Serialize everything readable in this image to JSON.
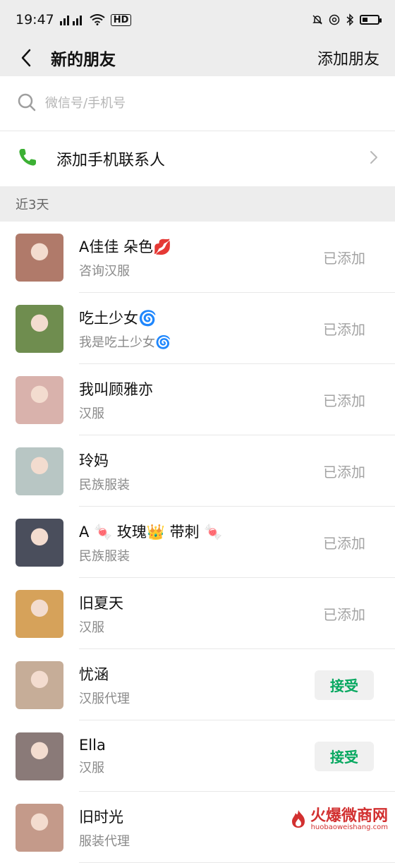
{
  "status_bar": {
    "time": "19:47",
    "signal1_label": "3G",
    "signal2_label": "4G",
    "hd_label": "HD"
  },
  "nav": {
    "title": "新的朋友",
    "action": "添加朋友"
  },
  "search": {
    "placeholder": "微信号/手机号"
  },
  "add_contacts": {
    "label": "添加手机联系人"
  },
  "section": {
    "title": "近3天"
  },
  "friends": [
    {
      "name": "A佳佳  朵色💋",
      "message": "咨询汉服",
      "status": "已添加",
      "avatar_color": "#b07a6a"
    },
    {
      "name": "吃土少女🌀",
      "message": "我是吃土少女🌀",
      "status": "已添加",
      "avatar_color": "#6f8d4f"
    },
    {
      "name": "我叫顾雅亦",
      "message": "汉服",
      "status": "已添加",
      "avatar_color": "#d9b2ac"
    },
    {
      "name": "玲妈",
      "message": "民族服装",
      "status": "已添加",
      "avatar_color": "#b8c6c4"
    },
    {
      "name": "A 🍬 玫瑰👑 带刺 🍬",
      "message": "民族服装",
      "status": "已添加",
      "avatar_color": "#4a4e5c"
    },
    {
      "name": "旧夏天",
      "message": "汉服",
      "status": "已添加",
      "avatar_color": "#d6a25a"
    },
    {
      "name": "忧涵",
      "message": "汉服代理",
      "accept_label": "接受",
      "avatar_color": "#c6ad98"
    },
    {
      "name": "Ella",
      "message": "汉服",
      "accept_label": "接受",
      "avatar_color": "#8a7a78"
    },
    {
      "name": "旧时光",
      "message": "服装代理",
      "avatar_color": "#c49a8a"
    }
  ],
  "watermark": {
    "text": "火爆微商网",
    "sub": "huobaoweishang.com"
  },
  "colors": {
    "header_bg": "#ededed",
    "accent_green": "#07a860",
    "phone_icon_green": "#3cb034",
    "muted_text": "#a3a3a3"
  },
  "icons": {
    "back": "chevron-left-icon",
    "search": "search-icon",
    "phone": "phone-icon",
    "chevron": "chevron-right-icon"
  }
}
